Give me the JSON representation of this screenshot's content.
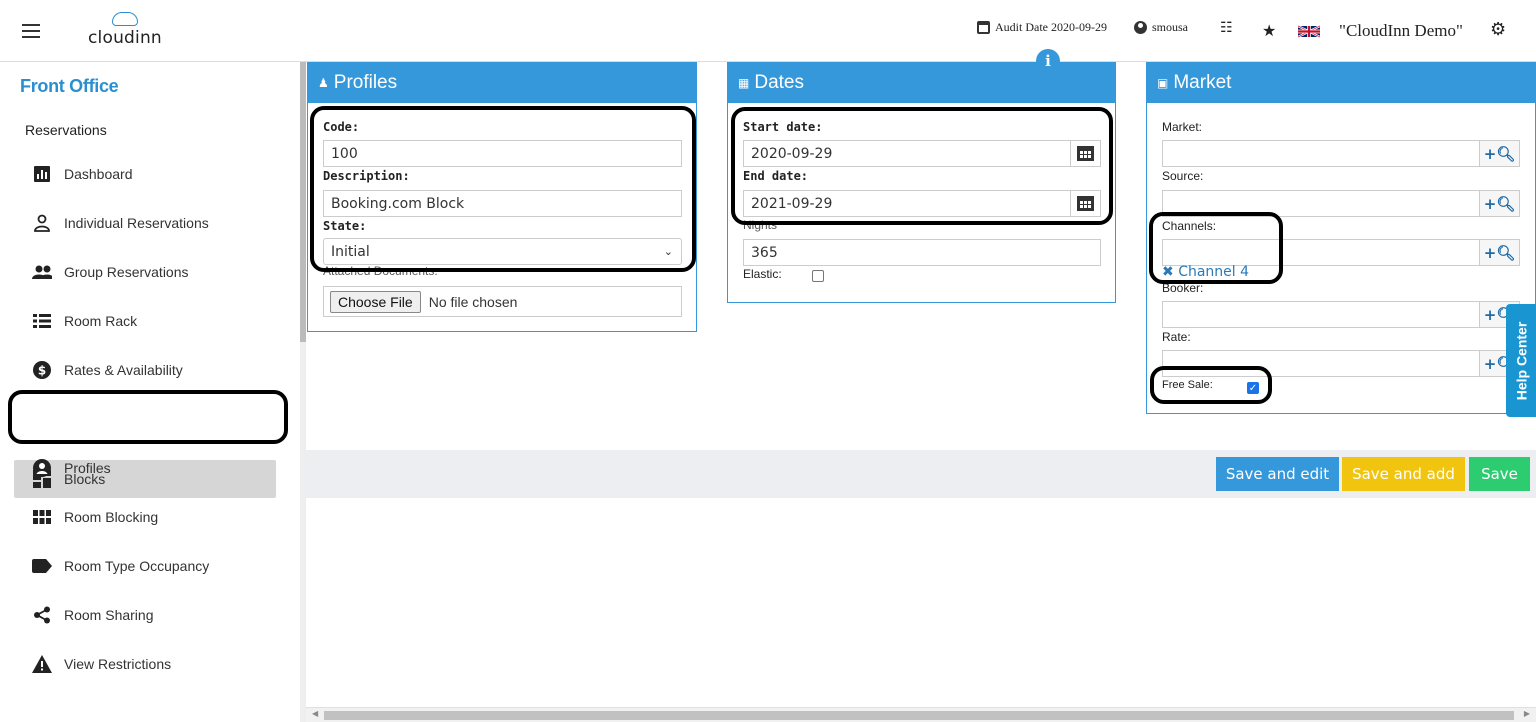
{
  "header": {
    "logo_text": "cloudinn",
    "audit_label": "Audit Date 2020-09-29",
    "username": "smousa",
    "hotel_name": "\"CloudInn Demo\""
  },
  "sidebar": {
    "title": "Front Office",
    "section": "Reservations",
    "items": [
      {
        "label": "Dashboard",
        "icon": "bar-chart-icon"
      },
      {
        "label": "Individual Reservations",
        "icon": "person-icon"
      },
      {
        "label": "Group Reservations",
        "icon": "group-icon"
      },
      {
        "label": "Room Rack",
        "icon": "list-icon"
      },
      {
        "label": "Rates & Availability",
        "icon": "dollar-icon"
      },
      {
        "label": "Blocks",
        "icon": "dashboard-blocks-icon",
        "active": true
      },
      {
        "label": "Profiles",
        "icon": "account-circle-icon"
      },
      {
        "label": "Room Blocking",
        "icon": "grid-icon"
      },
      {
        "label": "Room Type Occupancy",
        "icon": "label-icon"
      },
      {
        "label": "Room Sharing",
        "icon": "share-icon"
      },
      {
        "label": "View Restrictions",
        "icon": "warning-icon"
      }
    ]
  },
  "profiles": {
    "title": "Profiles",
    "code_label": "Code:",
    "code_value": "100",
    "description_label": "Description:",
    "description_value": "Booking.com Block",
    "state_label": "State:",
    "state_value": "Initial",
    "attached_label": "Attached Documents:",
    "file_button": "Choose File",
    "file_status": "No file chosen"
  },
  "dates": {
    "title": "Dates",
    "start_label": "Start date:",
    "start_value": "2020-09-29",
    "end_label": "End date:",
    "end_value": "2021-09-29",
    "nights_label": "Nights",
    "nights_value": "365",
    "elastic_label": "Elastic:",
    "elastic_checked": false
  },
  "market": {
    "title": "Market",
    "market_label": "Market:",
    "source_label": "Source:",
    "channels_label": "Channels:",
    "channel_tag": "Channel 4",
    "booker_label": "Booker:",
    "rate_label": "Rate:",
    "free_sale_label": "Free Sale:",
    "free_sale_checked": true
  },
  "actions": {
    "save_edit": "Save and edit",
    "save_add": "Save and add",
    "save": "Save"
  },
  "help_center": "Help Center",
  "colors": {
    "primary": "#3498db",
    "save_edit": "#3498db",
    "save_add": "#f1c40f",
    "save": "#2ecc71"
  }
}
